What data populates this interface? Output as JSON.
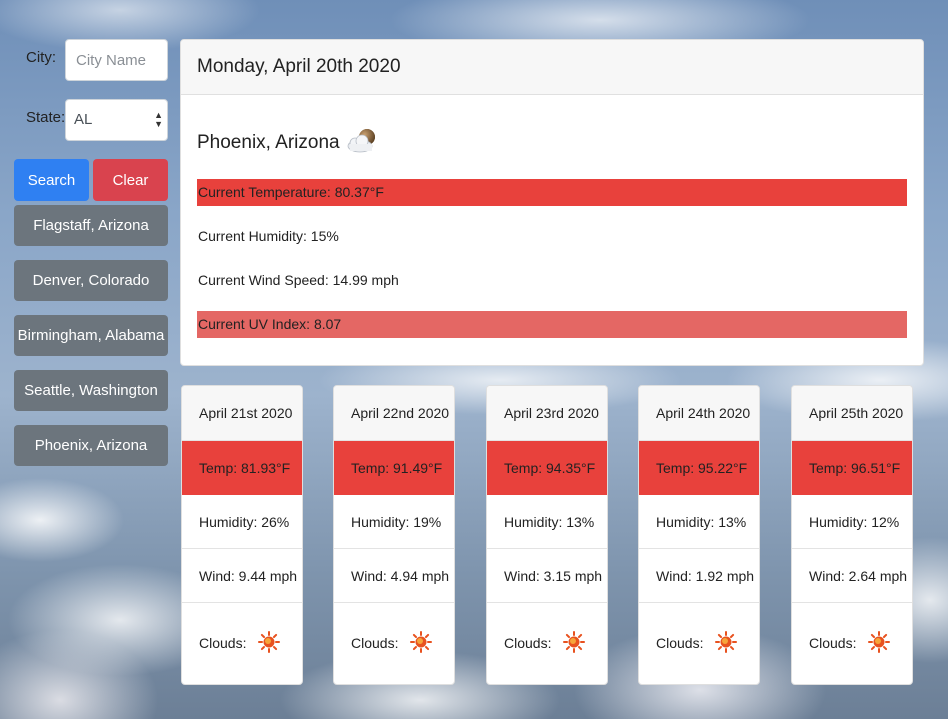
{
  "search": {
    "city_label": "City:",
    "city_placeholder": "City Name",
    "state_label": "State:",
    "state_value": "AL",
    "search_label": "Search",
    "clear_label": "Clear"
  },
  "history": [
    "Flagstaff, Arizona",
    "Denver, Colorado",
    "Birmingham, Alabama",
    "Seattle, Washington",
    "Phoenix, Arizona"
  ],
  "current": {
    "date": "Monday, April 20th 2020",
    "location": "Phoenix, Arizona",
    "icon": "partly-cloudy-icon",
    "temperature": "Current Temperature: 80.37°F",
    "humidity": "Current Humidity: 15%",
    "wind": "Current Wind Speed: 14.99 mph",
    "uv": "Current UV Index: 8.07"
  },
  "forecast": [
    {
      "date": "April 21st 2020",
      "temp": "Temp: 81.93°F",
      "humidity": "Humidity: 26%",
      "wind": "Wind: 9.44 mph",
      "clouds": "Clouds:",
      "icon": "sun-icon"
    },
    {
      "date": "April 22nd 2020",
      "temp": "Temp: 91.49°F",
      "humidity": "Humidity: 19%",
      "wind": "Wind: 4.94 mph",
      "clouds": "Clouds:",
      "icon": "sun-icon"
    },
    {
      "date": "April 23rd 2020",
      "temp": "Temp: 94.35°F",
      "humidity": "Humidity: 13%",
      "wind": "Wind: 3.15 mph",
      "clouds": "Clouds:",
      "icon": "sun-icon"
    },
    {
      "date": "April 24th 2020",
      "temp": "Temp: 95.22°F",
      "humidity": "Humidity: 13%",
      "wind": "Wind: 1.92 mph",
      "clouds": "Clouds:",
      "icon": "sun-icon"
    },
    {
      "date": "April 25th 2020",
      "temp": "Temp: 96.51°F",
      "humidity": "Humidity: 12%",
      "wind": "Wind: 2.64 mph",
      "clouds": "Clouds:",
      "icon": "sun-icon"
    }
  ],
  "colors": {
    "search_button": "#2f80f2",
    "clear_button": "#d9434e",
    "history_button": "#6c757d",
    "temp_highlight": "#e8413c",
    "uv_highlight": "#e46764"
  }
}
